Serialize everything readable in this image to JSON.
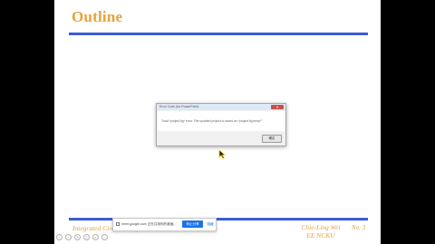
{
  "slide": {
    "title": "Outline",
    "footer_left": "Integrated Circuit Design",
    "footer_right_line1": "Chie-Ling Wei",
    "footer_right_line2": "EE NCKU",
    "footer_page": "No. 3"
  },
  "dialog": {
    "title": "Error Code (for PowerPoint)",
    "close_label": "✕",
    "message": "\"load *project.fig* error: File updated project is saved as *project.fig.temp*\"",
    "ok_label": "確定"
  },
  "share_bar": {
    "text": "meet.google.com 正在共用你的畫面。",
    "stop_label": "停止分享",
    "hide_label": "隱藏"
  },
  "controls": {
    "icons": [
      "prev-icon",
      "next-icon",
      "pen-icon",
      "menu-icon",
      "zoom-icon",
      "more-icon"
    ],
    "glyphs": [
      "‹",
      "›",
      "✎",
      "≡",
      "⌕",
      "…"
    ]
  },
  "colors": {
    "accent_orange": "#e8a23a",
    "rule_blue": "#3b5cd6",
    "button_blue": "#1a73e8"
  }
}
